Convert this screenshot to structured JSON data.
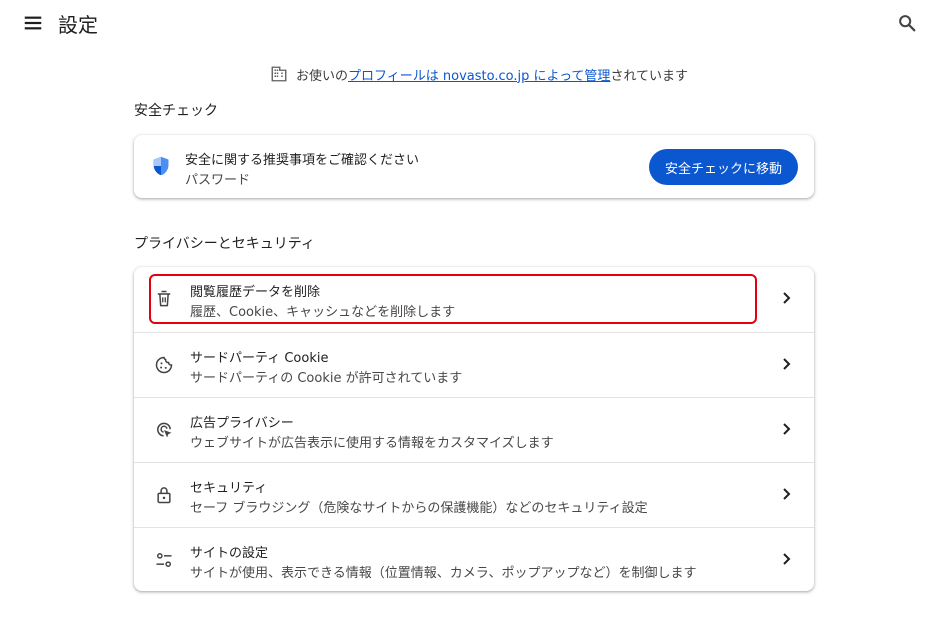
{
  "header": {
    "title": "設定",
    "menu_icon": "hamburger-menu-icon",
    "search_icon": "search-icon"
  },
  "managed_notice": {
    "prefix": "お使いの",
    "link_text": "プロフィールは novasto.co.jp によって管理",
    "suffix": "されています",
    "icon": "building-icon"
  },
  "safety_check": {
    "section_title": "安全チェック",
    "line1": "安全に関する推奨事項をご確認ください",
    "line2": "パスワード",
    "button_label": "安全チェックに移動",
    "icon": "shield-icon"
  },
  "privacy": {
    "section_title": "プライバシーとセキュリティ",
    "items": [
      {
        "title": "閲覧履歴データを削除",
        "subtitle": "履歴、Cookie、キャッシュなどを削除します",
        "icon": "trash-icon"
      },
      {
        "title": "サードパーティ Cookie",
        "subtitle": "サードパーティの Cookie が許可されています",
        "icon": "cookie-icon"
      },
      {
        "title": "広告プライバシー",
        "subtitle": "ウェブサイトが広告表示に使用する情報をカスタマイズします",
        "icon": "ad-privacy-icon"
      },
      {
        "title": "セキュリティ",
        "subtitle": "セーフ ブラウジング（危険なサイトからの保護機能）などのセキュリティ設定",
        "icon": "lock-icon"
      },
      {
        "title": "サイトの設定",
        "subtitle": "サイトが使用、表示できる情報（位置情報、カメラ、ポップアップなど）を制御します",
        "icon": "tune-icon"
      }
    ]
  },
  "colors": {
    "accent": "#0b57d0",
    "highlight_border": "#e3000f"
  }
}
